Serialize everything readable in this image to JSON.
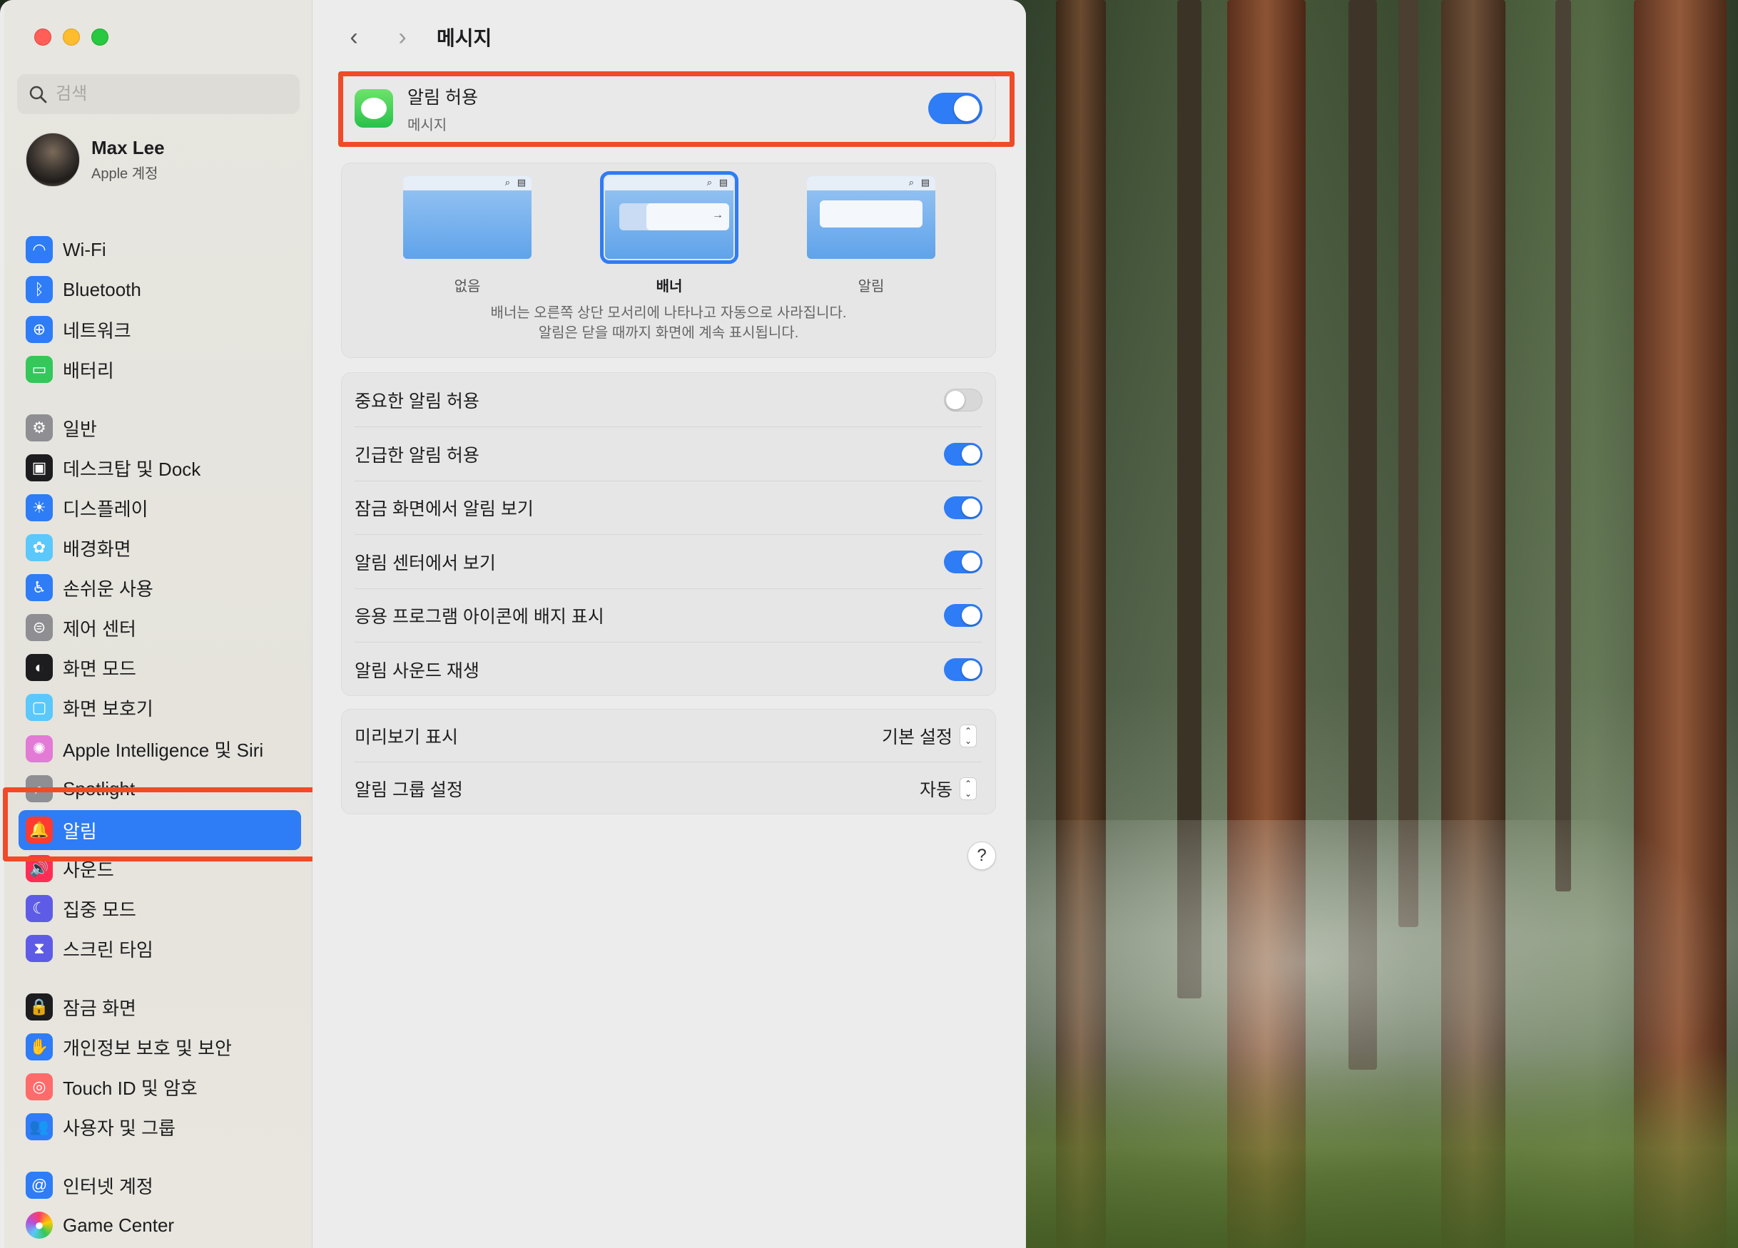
{
  "window": {
    "title": "메시지",
    "search_placeholder": "검색"
  },
  "profile": {
    "name": "Max Lee",
    "subtitle": "Apple 계정"
  },
  "sidebar": {
    "items": [
      {
        "label": "Wi-Fi",
        "icon": "wifi-icon",
        "color": "#2e7cf6"
      },
      {
        "label": "Bluetooth",
        "icon": "bluetooth-icon",
        "color": "#2e7cf6"
      },
      {
        "label": "네트워크",
        "icon": "globe-icon",
        "color": "#2e7cf6"
      },
      {
        "label": "배터리",
        "icon": "battery-icon",
        "color": "#34c759"
      },
      {
        "label": "일반",
        "icon": "gear-icon",
        "color": "#8e8e93"
      },
      {
        "label": "데스크탑 및 Dock",
        "icon": "dock-icon",
        "color": "#1d1d1f"
      },
      {
        "label": "디스플레이",
        "icon": "sun-icon",
        "color": "#2e7cf6"
      },
      {
        "label": "배경화면",
        "icon": "flower-icon",
        "color": "#5ac8fa"
      },
      {
        "label": "손쉬운 사용",
        "icon": "accessibility-icon",
        "color": "#2e7cf6"
      },
      {
        "label": "제어 센터",
        "icon": "switches-icon",
        "color": "#8e8e93"
      },
      {
        "label": "화면 모드",
        "icon": "appearance-icon",
        "color": "#1d1d1f"
      },
      {
        "label": "화면 보호기",
        "icon": "screensaver-icon",
        "color": "#5ac8fa"
      },
      {
        "label": "Apple Intelligence 및 Siri",
        "icon": "siri-icon",
        "color": "#e27ad6"
      },
      {
        "label": "Spotlight",
        "icon": "magnifier-icon",
        "color": "#8e8e93"
      },
      {
        "label": "알림",
        "icon": "bell-icon",
        "color": "#ff3b30"
      },
      {
        "label": "사운드",
        "icon": "speaker-icon",
        "color": "#ff2d55"
      },
      {
        "label": "집중 모드",
        "icon": "moon-icon",
        "color": "#5e5ce6"
      },
      {
        "label": "스크린 타임",
        "icon": "hourglass-icon",
        "color": "#5e5ce6"
      },
      {
        "label": "잠금 화면",
        "icon": "lock-icon",
        "color": "#1d1d1f"
      },
      {
        "label": "개인정보 보호 및 보안",
        "icon": "hand-icon",
        "color": "#2e7cf6"
      },
      {
        "label": "Touch ID 및 암호",
        "icon": "fingerprint-icon",
        "color": "#ff6b6b"
      },
      {
        "label": "사용자 및 그룹",
        "icon": "users-icon",
        "color": "#2e7cf6"
      },
      {
        "label": "인터넷 계정",
        "icon": "at-icon",
        "color": "#2e7cf6"
      },
      {
        "label": "Game Center",
        "icon": "gamecenter-icon",
        "color": "#ffffff"
      }
    ],
    "selected_index": 14
  },
  "main": {
    "allow": {
      "title": "알림 허용",
      "subtitle": "메시지",
      "on": true
    },
    "styles": {
      "options": [
        "없음",
        "배너",
        "알림"
      ],
      "selected_index": 1,
      "description_line1": "배너는 오른쪽 상단 모서리에 나타나고 자동으로 사라집니다.",
      "description_line2": "알림은 닫을 때까지 화면에 계속 표시됩니다."
    },
    "toggles": [
      {
        "label": "중요한 알림 허용",
        "on": false
      },
      {
        "label": "긴급한 알림 허용",
        "on": true
      },
      {
        "label": "잠금 화면에서 알림 보기",
        "on": true
      },
      {
        "label": "알림 센터에서 보기",
        "on": true
      },
      {
        "label": "응용 프로그램 아이콘에 배지 표시",
        "on": true
      },
      {
        "label": "알림 사운드 재생",
        "on": true
      }
    ],
    "selects": [
      {
        "label": "미리보기 표시",
        "value": "기본 설정"
      },
      {
        "label": "알림 그룹 설정",
        "value": "자동"
      }
    ],
    "help": "?"
  },
  "colors": {
    "accent": "#2e7cf6",
    "highlight": "#f04a28"
  }
}
